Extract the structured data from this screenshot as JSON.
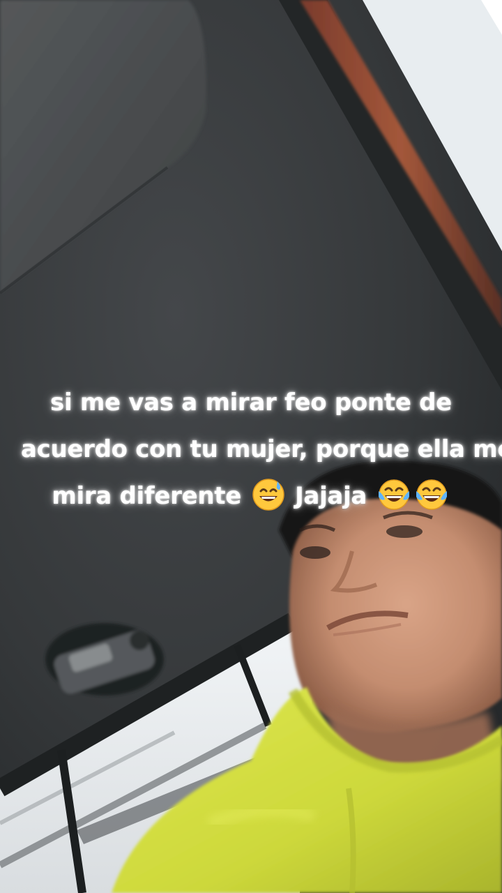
{
  "caption": {
    "line1": "si me vas a mirar feo ponte de",
    "line2": "acuerdo con tu mujer, porque ella me",
    "line3_text1": "mira diferente",
    "line3_text2": "Jajaja",
    "emojis": [
      "grinning-sweat-emoji",
      "tears-of-joy-emoji",
      "tears-of-joy-emoji"
    ]
  },
  "colors": {
    "caption_text": "#ffffff",
    "headliner": "#3a3d3c",
    "hoodie": "#d6e043",
    "window": "#eef2f4"
  }
}
